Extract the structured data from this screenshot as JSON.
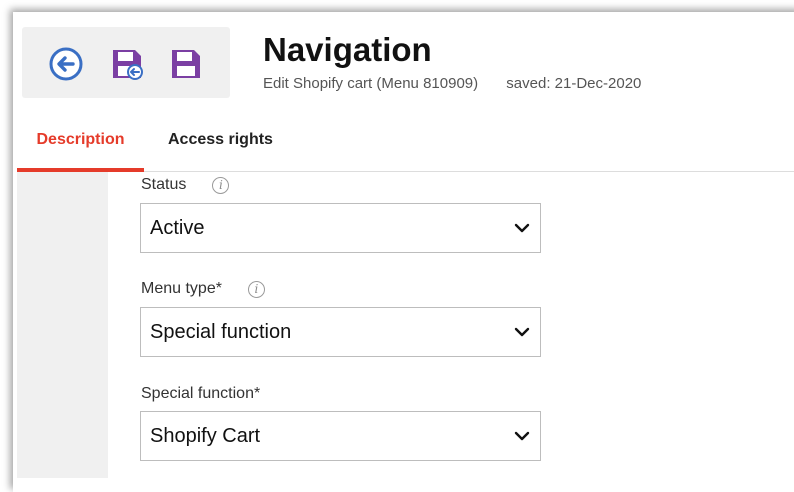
{
  "header": {
    "title": "Navigation",
    "subtitle": "Edit Shopify cart (Menu 810909)",
    "saved": "saved: 21-Dec-2020"
  },
  "toolbar": {
    "buttons": [
      {
        "icon": "back-icon",
        "color": "#3a6fc4"
      },
      {
        "icon": "save-and-return-icon",
        "color": "#7b3fa3"
      },
      {
        "icon": "save-icon",
        "color": "#7b3fa3"
      }
    ]
  },
  "tabs": [
    {
      "label": "Description",
      "active": true
    },
    {
      "label": "Access rights",
      "active": false
    }
  ],
  "form": {
    "status": {
      "label": "Status",
      "value": "Active"
    },
    "menu_type": {
      "label": "Menu type*",
      "value": "Special function"
    },
    "special_function": {
      "label": "Special function*",
      "value": "Shopify Cart"
    },
    "info_glyph": "i"
  },
  "colors": {
    "accent": "#e53b2a",
    "toolbar_bg": "#f0f0f0",
    "sidebar_bg": "#f0f0f0"
  }
}
